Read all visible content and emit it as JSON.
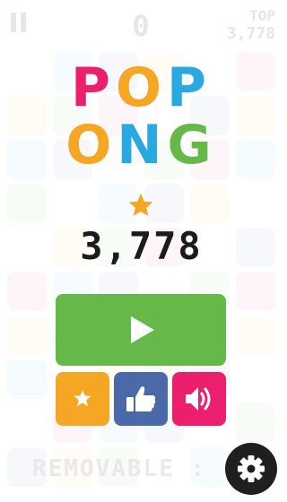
{
  "hud": {
    "score": "0",
    "top_label": "TOP",
    "top_value": "3,778"
  },
  "logo": {
    "line1": [
      {
        "char": "P",
        "color": "#ec1f6e"
      },
      {
        "char": "O",
        "color": "#f5a623"
      },
      {
        "char": "P",
        "color": "#2aa8e0"
      }
    ],
    "line2": [
      {
        "char": "O",
        "color": "#f5a623"
      },
      {
        "char": "N",
        "color": "#2aa8e0"
      },
      {
        "char": "G",
        "color": "#66b948"
      }
    ]
  },
  "best_score": "3,778",
  "menu": {
    "play_icon": "play-icon",
    "rate_icon": "star-icon",
    "like_icon": "thumbs-up-icon",
    "sound_icon": "speaker-icon",
    "settings_icon": "gear-icon"
  },
  "footer": {
    "removable_text": "REMOVABLE :"
  },
  "colors": {
    "play": "#66b948",
    "rate": "#f5a623",
    "like": "#4a69a8",
    "sound": "#ec1f6e",
    "settings": "#1f1f1f",
    "star": "#f5a623"
  }
}
